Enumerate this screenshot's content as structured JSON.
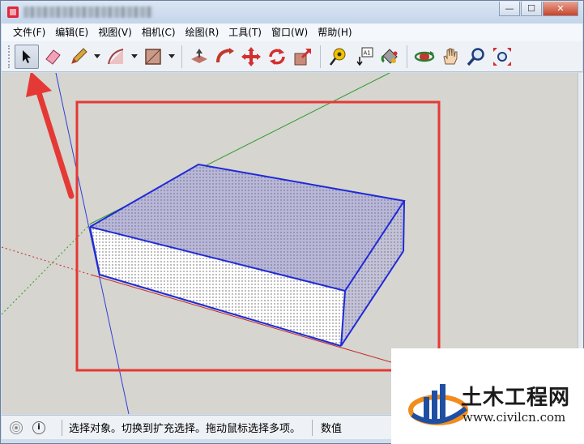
{
  "window": {
    "title_blurred": "",
    "buttons": {
      "minimize": "—",
      "maximize": "☐",
      "close": "✕"
    }
  },
  "menubar": {
    "items": [
      "文件(F)",
      "编辑(E)",
      "视图(V)",
      "相机(C)",
      "绘图(R)",
      "工具(T)",
      "窗口(W)",
      "帮助(H)"
    ]
  },
  "toolbar": {
    "tools": [
      "select-icon",
      "eraser-icon",
      "pencil-icon",
      "arc-icon",
      "rectangle-icon",
      "push-pull-icon",
      "follow-me-icon",
      "move-icon",
      "rotate-icon",
      "scale-icon",
      "tape-measure-icon",
      "text-icon",
      "paint-bucket-icon",
      "orbit-icon",
      "pan-icon",
      "zoom-icon",
      "zoom-extents-icon"
    ],
    "text_tool_label": "A1"
  },
  "viewport": {
    "background": "#d6d5cf",
    "highlight_color": "#e53935",
    "model_edge_color": "#1f2ad6"
  },
  "statusbar": {
    "hint": "选择对象。切换到扩充选择。拖动鼠标选择多项。",
    "value_label": "数值"
  },
  "watermark": {
    "name": "土木工程网",
    "url": "www.civilcn.com"
  }
}
